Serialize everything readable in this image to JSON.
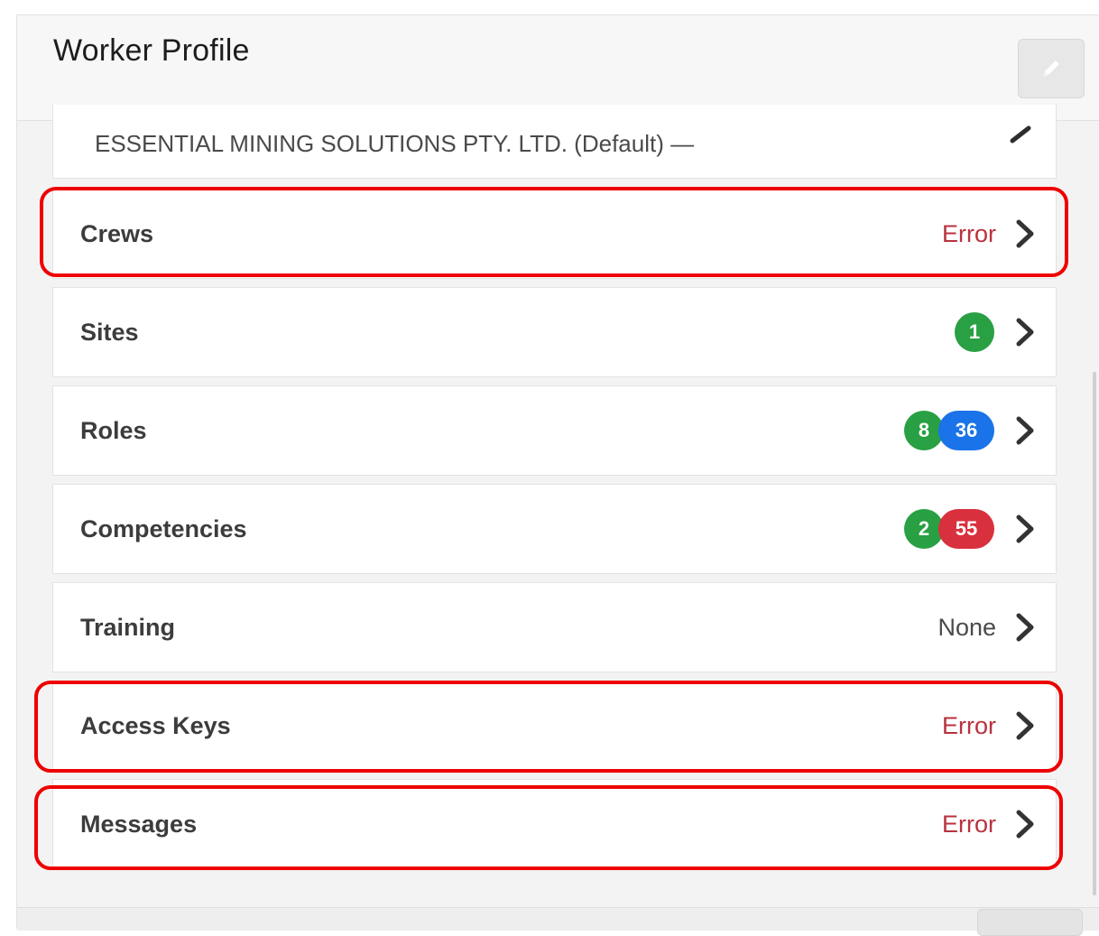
{
  "header": {
    "title": "Worker Profile",
    "edit_icon": "pencil-icon"
  },
  "company": {
    "text": "ESSENTIAL MINING SOLUTIONS PTY. LTD. (Default) —"
  },
  "rows": [
    {
      "label": "Crews",
      "status": "Error"
    },
    {
      "label": "Sites",
      "badges": [
        {
          "value": "1",
          "color": "#28a043"
        }
      ]
    },
    {
      "label": "Roles",
      "badges": [
        {
          "value": "8",
          "color": "#28a043"
        },
        {
          "value": "36",
          "color": "#1a73e8"
        }
      ]
    },
    {
      "label": "Competencies",
      "badges": [
        {
          "value": "2",
          "color": "#28a043"
        },
        {
          "value": "55",
          "color": "#d9303e"
        }
      ]
    },
    {
      "label": "Training",
      "status": "None"
    },
    {
      "label": "Access Keys",
      "status": "Error"
    },
    {
      "label": "Messages",
      "status": "Error"
    }
  ],
  "colors": {
    "error_text": "#b8323f",
    "highlight": "#ee0000",
    "success": "#28a043",
    "primary": "#1a73e8",
    "danger": "#d9303e"
  },
  "icons": {
    "row_arrow": "chevron-right-icon"
  }
}
